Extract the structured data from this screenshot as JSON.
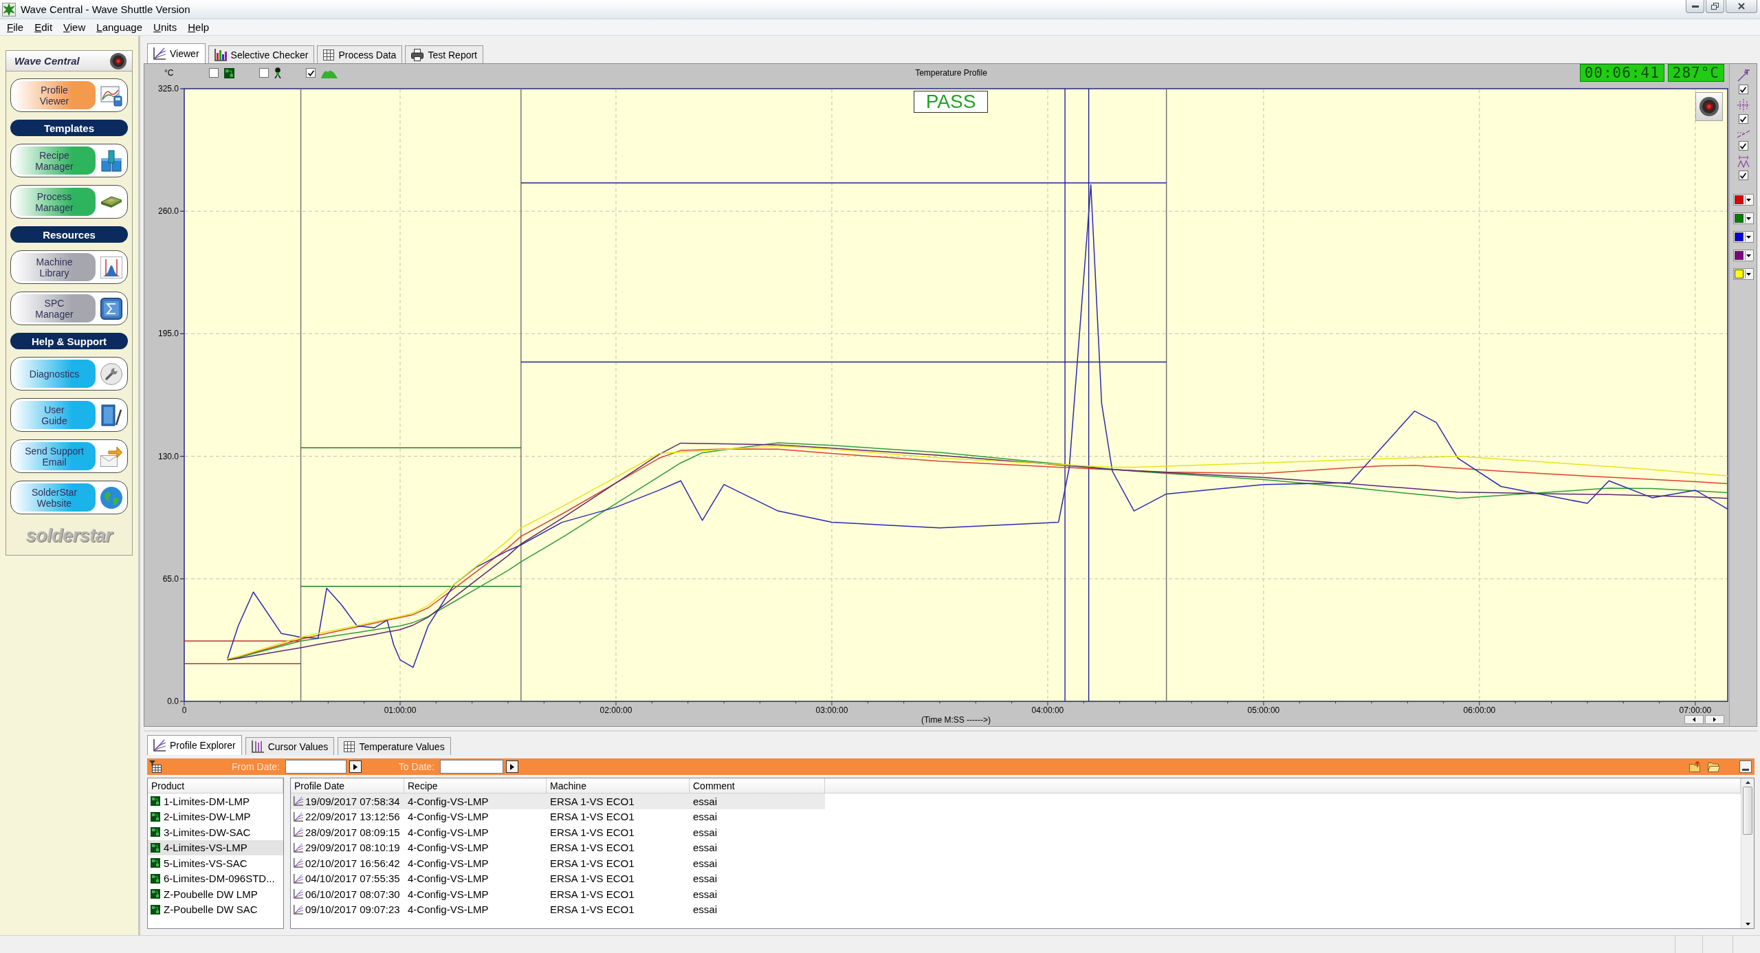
{
  "window": {
    "title": "Wave Central - Wave Shuttle Version"
  },
  "menu": [
    "File",
    "Edit",
    "View",
    "Language",
    "Units",
    "Help"
  ],
  "sidebar": {
    "title": "Wave Central",
    "items": [
      {
        "kind": "button",
        "label": "Profile\nViewer",
        "color": "#f39a4e"
      },
      {
        "kind": "section",
        "label": "Templates"
      },
      {
        "kind": "button",
        "label": "Recipe\nManager",
        "color": "#2fb45e"
      },
      {
        "kind": "button",
        "label": "Process\nManager",
        "color": "#2fb45e"
      },
      {
        "kind": "section",
        "label": "Resources"
      },
      {
        "kind": "button",
        "label": "Machine\nLibrary",
        "color": "#a5a6ae"
      },
      {
        "kind": "button",
        "label": "SPC\nManager",
        "color": "#a5a6ae"
      },
      {
        "kind": "section",
        "label": "Help & Support"
      },
      {
        "kind": "button",
        "label": "Diagnostics",
        "color": "#1ab3ea"
      },
      {
        "kind": "button",
        "label": "User\nGuide",
        "color": "#1ab3ea"
      },
      {
        "kind": "button",
        "label": "Send Support\nEmail",
        "color": "#1ab3ea"
      },
      {
        "kind": "button",
        "label": "SolderStar\nWebsite",
        "color": "#1ab3ea"
      }
    ],
    "logo": "solderstar"
  },
  "tabs": [
    {
      "label": "Viewer",
      "selected": true
    },
    {
      "label": "Selective Checker",
      "selected": false
    },
    {
      "label": "Process Data",
      "selected": false
    },
    {
      "label": "Test Report",
      "selected": false
    }
  ],
  "viewer": {
    "display_toggles": [
      {
        "kind": "board",
        "checked": false
      },
      {
        "kind": "probe",
        "checked": false
      },
      {
        "kind": "profile",
        "checked": true
      }
    ],
    "timer": "00:06:41",
    "temperature": "287°C",
    "result": "PASS",
    "tools": [
      {
        "kind": "zoom",
        "checked": true
      },
      {
        "kind": "crosshair",
        "checked": true
      },
      {
        "kind": "trend",
        "checked": true
      },
      {
        "kind": "peaks",
        "checked": true
      }
    ],
    "trace_colors": [
      {
        "color": "#e00000"
      },
      {
        "color": "#008000"
      },
      {
        "color": "#0000e0"
      },
      {
        "color": "#800080"
      },
      {
        "color": "#ffff00"
      }
    ],
    "chart_data": {
      "type": "line",
      "title": "Temperature Profile",
      "xlabel": "(Time M:SS ------>)",
      "ylabel": "°C",
      "x": [
        0,
        0.2,
        0.25,
        0.32,
        0.45,
        0.54,
        0.62,
        0.66,
        0.73,
        0.8,
        0.88,
        0.94,
        0.97,
        1.0,
        1.06,
        1.13,
        1.25,
        1.35,
        1.5,
        1.56,
        1.75,
        2.0,
        2.2,
        2.3,
        2.4,
        2.5,
        2.75,
        3.0,
        3.5,
        4.05,
        4.1,
        4.2,
        4.25,
        4.3,
        4.4,
        4.55,
        5.0,
        5.4,
        5.55,
        5.7,
        5.8,
        5.9,
        6.1,
        6.5,
        6.6,
        6.8,
        7.0,
        7.15
      ],
      "series": [
        {
          "color": "#c03030",
          "values": [
            32,
            32,
            32,
            32,
            32,
            32,
            null,
            null,
            null,
            null,
            null,
            null,
            null,
            null,
            null,
            null,
            null,
            null,
            null,
            null,
            null,
            null,
            null,
            null,
            null,
            null,
            null,
            null,
            null,
            null,
            null,
            null,
            null,
            null,
            null,
            null,
            null,
            null,
            null,
            null,
            null,
            null,
            null,
            null,
            null,
            null,
            null,
            null
          ]
        },
        {
          "color": "#c03030",
          "values": [
            20,
            20,
            20,
            20,
            20,
            20,
            null,
            null,
            null,
            null,
            null,
            null,
            null,
            null,
            null,
            null,
            null,
            null,
            null,
            null,
            null,
            null,
            null,
            null,
            null,
            null,
            null,
            null,
            null,
            null,
            null,
            null,
            null,
            null,
            null,
            null,
            null,
            null,
            null,
            null,
            null,
            null,
            null,
            null,
            null,
            null,
            null,
            null
          ]
        },
        {
          "color": "#208020",
          "values": [
            null,
            null,
            null,
            null,
            null,
            134.5,
            134.5,
            134.5,
            134.5,
            134.5,
            134.5,
            134.5,
            134.5,
            134.5,
            134.5,
            134.5,
            134.5,
            134.5,
            134.5,
            134.5,
            null,
            null,
            null,
            null,
            null,
            null,
            null,
            null,
            null,
            null,
            null,
            null,
            null,
            null,
            null,
            null,
            null,
            null,
            null,
            null,
            null,
            null,
            null,
            null,
            null,
            null,
            null,
            null
          ]
        },
        {
          "color": "#208020",
          "values": [
            null,
            null,
            null,
            null,
            null,
            61,
            61,
            61,
            61,
            61,
            61,
            61,
            61,
            61,
            61,
            61,
            61,
            61,
            61,
            61,
            null,
            null,
            null,
            null,
            null,
            null,
            null,
            null,
            null,
            null,
            null,
            null,
            null,
            null,
            null,
            null,
            null,
            null,
            null,
            null,
            null,
            null,
            null,
            null,
            null,
            null,
            null,
            null
          ]
        },
        {
          "color": "#2020a0",
          "values": [
            null,
            null,
            null,
            null,
            null,
            null,
            null,
            null,
            null,
            null,
            null,
            null,
            null,
            null,
            null,
            null,
            null,
            null,
            null,
            275,
            275,
            275,
            275,
            275,
            275,
            275,
            275,
            275,
            275,
            275,
            275,
            275,
            275,
            275,
            275,
            275,
            null,
            null,
            null,
            null,
            null,
            null,
            null,
            null,
            null,
            null,
            null,
            null
          ]
        },
        {
          "color": "#2020a0",
          "values": [
            null,
            null,
            null,
            null,
            null,
            null,
            null,
            null,
            null,
            null,
            null,
            null,
            null,
            null,
            null,
            null,
            null,
            null,
            null,
            180,
            180,
            180,
            180,
            180,
            180,
            180,
            180,
            180,
            180,
            180,
            180,
            180,
            180,
            180,
            180,
            180,
            null,
            null,
            null,
            null,
            null,
            null,
            null,
            null,
            null,
            null,
            null,
            null
          ]
        },
        {
          "color": "#d8432c",
          "values": [
            null,
            22,
            23.3,
            25.7,
            30,
            33,
            35,
            36,
            37.8,
            39.5,
            41.5,
            43,
            43.8,
            44.5,
            46,
            49.6,
            59.9,
            68.5,
            81.5,
            87.5,
            99.4,
            115.9,
            129,
            133.1,
            133.5,
            133.9,
            133.8,
            131.5,
            127.4,
            124.2,
            124,
            123.4,
            123.1,
            122.9,
            122.4,
            121.6,
            120.9,
            123.9,
            124.9,
            125.2,
            124.4,
            123.6,
            122.1,
            119.5,
            118.9,
            117.7,
            116.5,
            115.5
          ]
        },
        {
          "color": "#2f9a3a",
          "values": [
            null,
            22,
            23.2,
            25.3,
            29.3,
            32,
            33.4,
            34.1,
            35.3,
            36.5,
            37.9,
            39,
            39.5,
            40,
            41.8,
            45,
            52.9,
            59.5,
            69.4,
            74,
            86.9,
            104.9,
            119.3,
            126.5,
            131.9,
            133.4,
            137.1,
            135.8,
            132,
            125.9,
            125.3,
            124.2,
            123.6,
            123.1,
            122.1,
            120.9,
            117.6,
            113.5,
            111.7,
            110,
            108.9,
            107.7,
            109.2,
            112.3,
            113.1,
            112.9,
            111.7,
            110.7
          ]
        },
        {
          "color": "#2a2ab0",
          "values": [
            null,
            22.5,
            40,
            58,
            36,
            34,
            33.5,
            60,
            51,
            40,
            39,
            43,
            30,
            22,
            18,
            40,
            62,
            71,
            80,
            83,
            95,
            103,
            112,
            117,
            96,
            115,
            101,
            95,
            92,
            95,
            124,
            274,
            158,
            122,
            101,
            110,
            115,
            116,
            135,
            154,
            148,
            129,
            114,
            105,
            117,
            108,
            112,
            102
          ]
        },
        {
          "color": "#5a2a6e",
          "values": [
            null,
            22,
            22.8,
            24.2,
            26.7,
            28.5,
            30.2,
            31,
            32.4,
            33.9,
            35.5,
            36.8,
            37.4,
            38,
            40.4,
            44.6,
            55.2,
            64.1,
            77.3,
            83.5,
            97.1,
            115.9,
            131,
            137,
            136.8,
            136.6,
            136.1,
            134.3,
            130.5,
            125.4,
            124.9,
            124,
            123.5,
            123,
            122.4,
            121.4,
            118.7,
            115.5,
            114.1,
            112.8,
            111.9,
            111,
            110.6,
            109.8,
            109.7,
            109.1,
            108.4,
            107.7
          ]
        },
        {
          "color": "#e6e41e",
          "values": [
            null,
            22.5,
            23.9,
            26.3,
            30.9,
            34,
            36,
            36.9,
            38.6,
            40.2,
            42.1,
            43.6,
            44.3,
            45,
            46.8,
            50.8,
            62,
            71.4,
            85.4,
            92,
            103.3,
            119,
            131.5,
            132.2,
            133,
            133.7,
            135.5,
            133.7,
            129.1,
            125.7,
            125.4,
            124.8,
            124.5,
            124.2,
            124.2,
            124.8,
            126.5,
            128.1,
            128.7,
            129.2,
            129.6,
            130,
            128.5,
            125.4,
            124.6,
            122.9,
            121,
            119.6
          ]
        }
      ],
      "xlim": [
        0,
        7.15
      ],
      "ylim": [
        0,
        325
      ],
      "xticks": [
        {
          "value": 0,
          "label": "0"
        },
        {
          "value": 1,
          "label": "01:00:00"
        },
        {
          "value": 2,
          "label": "02:00:00"
        },
        {
          "value": 3,
          "label": "03:00:00"
        },
        {
          "value": 4,
          "label": "04:00:00"
        },
        {
          "value": 5,
          "label": "05:00:00"
        },
        {
          "value": 6,
          "label": "06:00:00"
        },
        {
          "value": 7,
          "label": "07:00:00"
        }
      ],
      "yticks": [
        {
          "value": 0,
          "label": "0.0"
        },
        {
          "value": 65,
          "label": "65.0"
        },
        {
          "value": 130,
          "label": "130.0"
        },
        {
          "value": 195,
          "label": "195.0"
        },
        {
          "value": 260,
          "label": "260.0"
        },
        {
          "value": 325,
          "label": "325.0"
        }
      ],
      "grid": true,
      "ref_lines": [
        {
          "axis": "x",
          "value": 0.54,
          "color": "#6e6e6e"
        },
        {
          "axis": "x",
          "value": 1.56,
          "color": "#6e6e6e"
        },
        {
          "axis": "x",
          "value": 4.55,
          "color": "#6e6e6e"
        },
        {
          "axis": "x",
          "value": 4.08,
          "color": "#2020a0"
        },
        {
          "axis": "x",
          "value": 4.19,
          "color": "#2020a0"
        }
      ]
    }
  },
  "bottom_tabs": [
    {
      "label": "Profile Explorer",
      "selected": true
    },
    {
      "label": "Cursor Values",
      "selected": false
    },
    {
      "label": "Temperature Values",
      "selected": false
    }
  ],
  "filter": {
    "from_label": "From Date:",
    "to_label": "To Date:"
  },
  "products": {
    "header": "Product",
    "items": [
      {
        "label": "1-Limites-DM-LMP",
        "selected": false
      },
      {
        "label": "2-Limites-DW-LMP",
        "selected": false
      },
      {
        "label": "3-Limites-DW-SAC",
        "selected": false
      },
      {
        "label": "4-Limites-VS-LMP",
        "selected": true
      },
      {
        "label": "5-Limites-VS-SAC",
        "selected": false
      },
      {
        "label": "6-Limites-DM-096STD...",
        "selected": false
      },
      {
        "label": "Z-Poubelle DW LMP",
        "selected": false
      },
      {
        "label": "Z-Poubelle DW SAC",
        "selected": false
      }
    ]
  },
  "profiles": {
    "columns": [
      "Profile Date",
      "Recipe",
      "Machine",
      "Comment"
    ],
    "rows": [
      {
        "selected": true,
        "cells": [
          "19/09/2017 07:58:34",
          "4-Config-VS-LMP",
          "ERSA 1-VS ECO1",
          "essai"
        ]
      },
      {
        "selected": false,
        "cells": [
          "22/09/2017 13:12:56",
          "4-Config-VS-LMP",
          "ERSA 1-VS ECO1",
          "essai"
        ]
      },
      {
        "selected": false,
        "cells": [
          "28/09/2017 08:09:15",
          "4-Config-VS-LMP",
          "ERSA 1-VS ECO1",
          "essai"
        ]
      },
      {
        "selected": false,
        "cells": [
          "29/09/2017 08:10:19",
          "4-Config-VS-LMP",
          "ERSA 1-VS ECO1",
          "essai"
        ]
      },
      {
        "selected": false,
        "cells": [
          "02/10/2017 16:56:42",
          "4-Config-VS-LMP",
          "ERSA 1-VS ECO1",
          "essai"
        ]
      },
      {
        "selected": false,
        "cells": [
          "04/10/2017 07:55:35",
          "4-Config-VS-LMP",
          "ERSA 1-VS ECO1",
          "essai"
        ]
      },
      {
        "selected": false,
        "cells": [
          "06/10/2017 08:07:30",
          "4-Config-VS-LMP",
          "ERSA 1-VS ECO1",
          "essai"
        ]
      },
      {
        "selected": false,
        "cells": [
          "09/10/2017 09:07:23",
          "4-Config-VS-LMP",
          "ERSA 1-VS ECO1",
          "essai"
        ]
      }
    ]
  }
}
